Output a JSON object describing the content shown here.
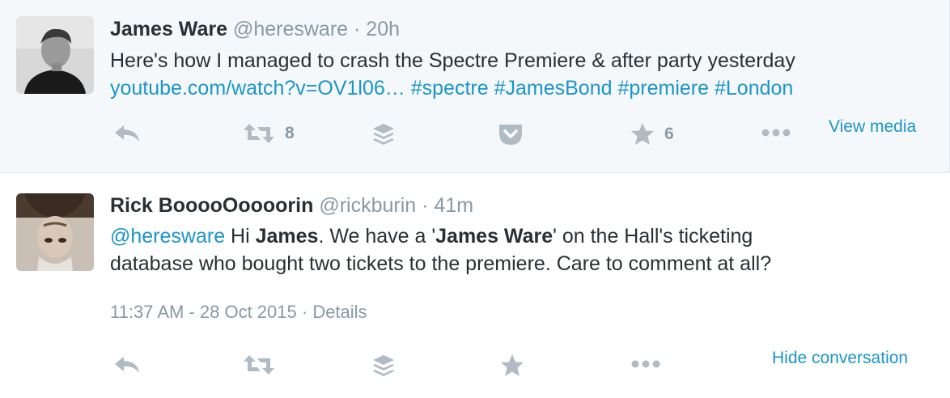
{
  "tweets": [
    {
      "fullname": "James Ware",
      "username": "@heresware",
      "separator": "·",
      "time": "20h",
      "text_line1": "Here's how I managed to crash the Spectre Premiere & after party yesterday",
      "link_url": "youtube.com/watch?v=OV1l06…",
      "hashtags": [
        "#spectre",
        "#JamesBond",
        "#premiere",
        "#London"
      ],
      "retweet_count": "8",
      "like_count": "6",
      "expand_label": "View media",
      "icons": [
        "reply-icon",
        "retweet-icon",
        "buffer-icon",
        "pocket-icon",
        "star-icon",
        "more-icon"
      ]
    },
    {
      "fullname": "Rick BooooOoooorin",
      "username": "@rickburin",
      "separator": "·",
      "time": "41m",
      "mention": "@heresware",
      "text_part1": " Hi ",
      "bold_name1": "James",
      "text_part2": ". We have a '",
      "bold_name2": "James Ware",
      "text_part3": "' on the Hall's ticketing",
      "text_line2": "database who bought two tickets to the premiere. Care to comment at all?",
      "timestamp": "11:37 AM - 28 Oct 2015",
      "meta_separator": "·",
      "details_label": "Details",
      "expand_label": "Hide conversation",
      "icons": [
        "reply-icon",
        "retweet-icon",
        "buffer-icon",
        "star-icon",
        "more-icon"
      ]
    }
  ],
  "colors": {
    "link": "#1b95c9",
    "muted": "#8899a6",
    "icon": "#b1bbc3",
    "text": "#292f33",
    "highlight_bg": "#f5f8fa"
  }
}
